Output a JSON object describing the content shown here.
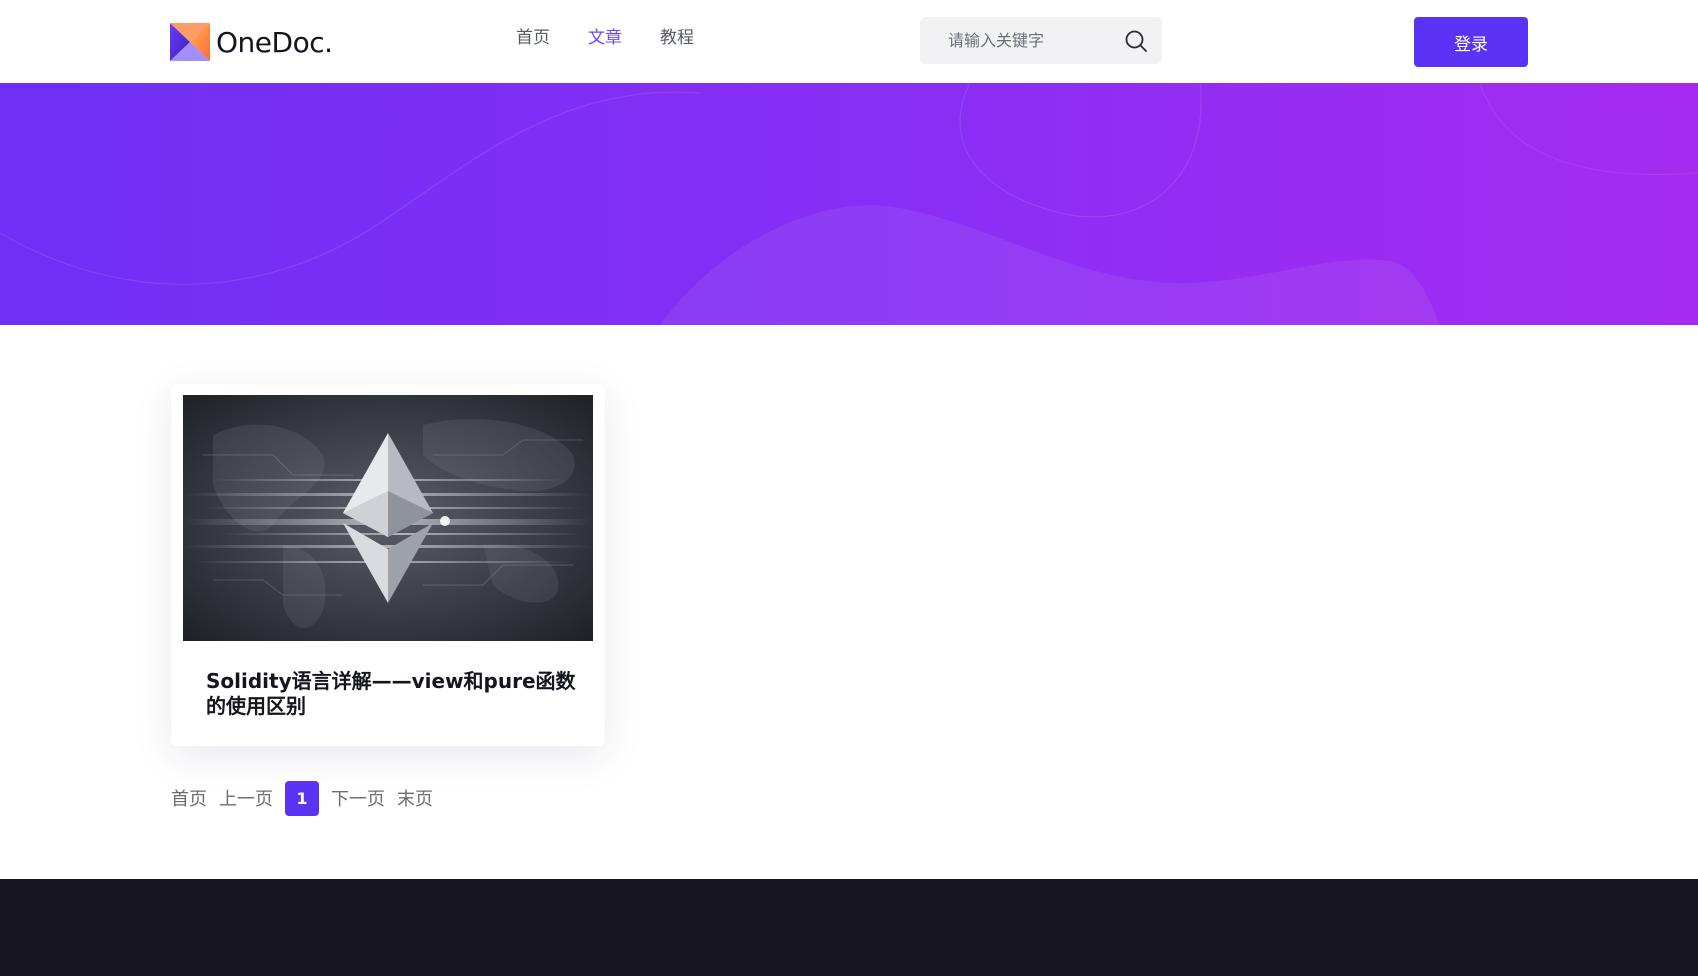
{
  "header": {
    "logo_text": "OneDoc.",
    "nav": [
      {
        "label": "首页",
        "active": false
      },
      {
        "label": "文章",
        "active": true
      },
      {
        "label": "教程",
        "active": false
      }
    ],
    "search": {
      "placeholder": "请输入关键字"
    },
    "login_label": "登录"
  },
  "articles": [
    {
      "title": "Solidity语言详解——view和pure函数的使用区别",
      "thumbnail_icon": "ethereum-logo"
    }
  ],
  "pagination": {
    "first": "首页",
    "prev": "上一页",
    "current": "1",
    "next": "下一页",
    "last": "末页"
  },
  "colors": {
    "accent": "#5a33f5",
    "nav_active": "#6b46ff",
    "banner_start": "#6f2ff5",
    "banner_end": "#a62bf0",
    "footer": "#161520"
  }
}
